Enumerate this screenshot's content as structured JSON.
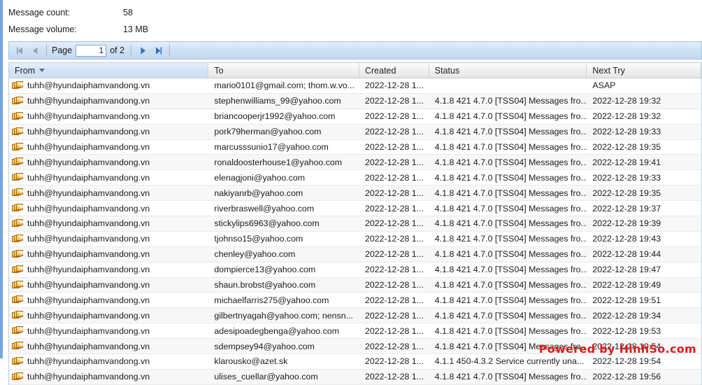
{
  "summary": {
    "count_label": "Message count:",
    "count_value": "58",
    "volume_label": "Message volume:",
    "volume_value": "13 MB"
  },
  "toolbar": {
    "first_icon": "first-page-icon",
    "prev_icon": "previous-page-icon",
    "next_icon": "next-page-icon",
    "last_icon": "last-page-icon",
    "page_label": "Page",
    "page_value": "1",
    "of_label": "of 2"
  },
  "grid": {
    "columns": [
      {
        "label": "From",
        "sorted": true,
        "sort_dir": "desc"
      },
      {
        "label": "To",
        "sorted": false
      },
      {
        "label": "Created",
        "sorted": false
      },
      {
        "label": "Status",
        "sorted": false
      },
      {
        "label": "Next Try",
        "sorted": false
      }
    ],
    "rows": [
      {
        "icon": "messages-icon",
        "from": "tuhh@hyundaiphamvandong.vn",
        "to": "mario0101@gmail.com; thom.w.vo...",
        "created": "2022-12-28 1...",
        "status": "",
        "next_try": "ASAP"
      },
      {
        "icon": "messages-icon",
        "from": "tuhh@hyundaiphamvandong.vn",
        "to": "stephenwilliams_99@yahoo.com",
        "created": "2022-12-28 1...",
        "status": "4.1.8 421 4.7.0 [TSS04] Messages fro...",
        "next_try": "2022-12-28 19:32"
      },
      {
        "icon": "messages-icon",
        "from": "tuhh@hyundaiphamvandong.vn",
        "to": "briancooperjr1992@yahoo.com",
        "created": "2022-12-28 1...",
        "status": "4.1.8 421 4.7.0 [TSS04] Messages fro...",
        "next_try": "2022-12-28 19:32"
      },
      {
        "icon": "messages-icon",
        "from": "tuhh@hyundaiphamvandong.vn",
        "to": "pork79herman@yahoo.com",
        "created": "2022-12-28 1...",
        "status": "4.1.8 421 4.7.0 [TSS04] Messages fro...",
        "next_try": "2022-12-28 19:33"
      },
      {
        "icon": "messages-icon",
        "from": "tuhh@hyundaiphamvandong.vn",
        "to": "marcusssunio17@yahoo.com",
        "created": "2022-12-28 1...",
        "status": "4.1.8 421 4.7.0 [TSS04] Messages fro...",
        "next_try": "2022-12-28 19:35"
      },
      {
        "icon": "messages-icon",
        "from": "tuhh@hyundaiphamvandong.vn",
        "to": "ronaldoosterhouse1@yahoo.com",
        "created": "2022-12-28 1...",
        "status": "4.1.8 421 4.7.0 [TSS04] Messages fro...",
        "next_try": "2022-12-28 19:41"
      },
      {
        "icon": "messages-icon",
        "from": "tuhh@hyundaiphamvandong.vn",
        "to": "elenagjoni@yahoo.com",
        "created": "2022-12-28 1...",
        "status": "4.1.8 421 4.7.0 [TSS04] Messages fro...",
        "next_try": "2022-12-28 19:33"
      },
      {
        "icon": "messages-icon",
        "from": "tuhh@hyundaiphamvandong.vn",
        "to": "nakiyanrb@yahoo.com",
        "created": "2022-12-28 1...",
        "status": "4.1.8 421 4.7.0 [TSS04] Messages fro...",
        "next_try": "2022-12-28 19:35"
      },
      {
        "icon": "messages-icon",
        "from": "tuhh@hyundaiphamvandong.vn",
        "to": "riverbraswell@yahoo.com",
        "created": "2022-12-28 1...",
        "status": "4.1.8 421 4.7.0 [TSS04] Messages fro...",
        "next_try": "2022-12-28 19:37"
      },
      {
        "icon": "messages-icon",
        "from": "tuhh@hyundaiphamvandong.vn",
        "to": "stickylips6963@yahoo.com",
        "created": "2022-12-28 1...",
        "status": "4.1.8 421 4.7.0 [TSS04] Messages fro...",
        "next_try": "2022-12-28 19:39"
      },
      {
        "icon": "messages-icon",
        "from": "tuhh@hyundaiphamvandong.vn",
        "to": "tjohnso15@yahoo.com",
        "created": "2022-12-28 1...",
        "status": "4.1.8 421 4.7.0 [TSS04] Messages fro...",
        "next_try": "2022-12-28 19:43"
      },
      {
        "icon": "messages-icon",
        "from": "tuhh@hyundaiphamvandong.vn",
        "to": "chenley@yahoo.com",
        "created": "2022-12-28 1...",
        "status": "4.1.8 421 4.7.0 [TSS04] Messages fro...",
        "next_try": "2022-12-28 19:44"
      },
      {
        "icon": "messages-icon",
        "from": "tuhh@hyundaiphamvandong.vn",
        "to": "dompierce13@yahoo.com",
        "created": "2022-12-28 1...",
        "status": "4.1.8 421 4.7.0 [TSS04] Messages fro...",
        "next_try": "2022-12-28 19:47"
      },
      {
        "icon": "messages-icon",
        "from": "tuhh@hyundaiphamvandong.vn",
        "to": "shaun.brobst@yahoo.com",
        "created": "2022-12-28 1...",
        "status": "4.1.8 421 4.7.0 [TSS04] Messages fro...",
        "next_try": "2022-12-28 19:49"
      },
      {
        "icon": "messages-icon",
        "from": "tuhh@hyundaiphamvandong.vn",
        "to": "michaelfarris275@yahoo.com",
        "created": "2022-12-28 1...",
        "status": "4.1.8 421 4.7.0 [TSS04] Messages fro...",
        "next_try": "2022-12-28 19:51"
      },
      {
        "icon": "messages-icon",
        "from": "tuhh@hyundaiphamvandong.vn",
        "to": "gilbertnyagah@yahoo.com; nensn...",
        "created": "2022-12-28 1...",
        "status": "4.1.8 421 4.7.0 [TSS04] Messages fro...",
        "next_try": "2022-12-28 19:34"
      },
      {
        "icon": "messages-icon",
        "from": "tuhh@hyundaiphamvandong.vn",
        "to": "adesipoadegbenga@yahoo.com",
        "created": "2022-12-28 1...",
        "status": "4.1.8 421 4.7.0 [TSS04] Messages fro...",
        "next_try": "2022-12-28 19:53"
      },
      {
        "icon": "messages-icon",
        "from": "tuhh@hyundaiphamvandong.vn",
        "to": "sdempsey94@yahoo.com",
        "created": "2022-12-28 1...",
        "status": "4.1.8 421 4.7.0 [TSS04] Messages fro...",
        "next_try": "2022-12-28 19:54"
      },
      {
        "icon": "messages-icon",
        "from": "tuhh@hyundaiphamvandong.vn",
        "to": "klarousko@azet.sk",
        "created": "2022-12-28 1...",
        "status": "4.1.1 450-4.3.2 Service currently una...",
        "next_try": "2022-12-28 19:54"
      },
      {
        "icon": "messages-icon",
        "from": "tuhh@hyundaiphamvandong.vn",
        "to": "ulises_cuellar@yahoo.com",
        "created": "2022-12-28 1...",
        "status": "4.1.8 421 4.7.0 [TSS04] Messages fro...",
        "next_try": "2022-12-28 19:56"
      }
    ]
  },
  "watermark": {
    "text": "Powered by HinhSo.com",
    "color": "#e01b1b"
  }
}
